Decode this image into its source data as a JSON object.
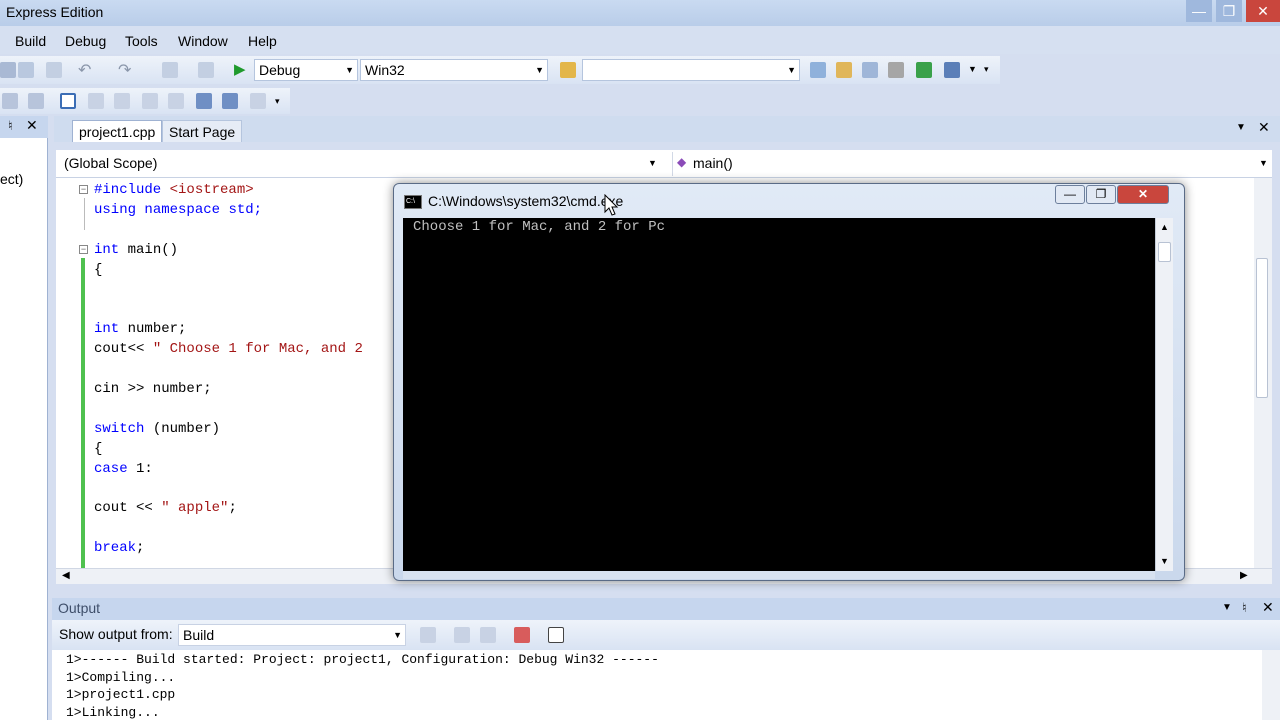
{
  "window": {
    "title": "Express Edition"
  },
  "menu": [
    "Build",
    "Debug",
    "Tools",
    "Window",
    "Help"
  ],
  "toolbar": {
    "config_value": "Debug",
    "platform_value": "Win32",
    "find_value": ""
  },
  "left_panel": {
    "text": "ect)"
  },
  "tabs": [
    {
      "label": "project1.cpp"
    },
    {
      "label": "Start Page"
    }
  ],
  "scope": {
    "left": "(Global Scope)",
    "right": "main()"
  },
  "code_lines": [
    "#include <iostream>",
    "using namespace std;",
    "int main()",
    "{",
    "int number;",
    "cout<< \" Choose 1 for Mac, and 2",
    "cin >> number;",
    "switch (number)",
    "{",
    "case 1:",
    "cout << \" apple\";",
    "break;"
  ],
  "output": {
    "title": "Output",
    "show_from_label": "Show output from:",
    "show_from_value": "Build",
    "lines": [
      "1>------ Build started: Project: project1, Configuration: Debug Win32 ------",
      "1>Compiling...",
      "1>project1.cpp",
      "1>Linking..."
    ]
  },
  "cmd": {
    "title": "C:\\Windows\\system32\\cmd.exe",
    "icon_text": "C:\\",
    "screen_text": "Choose 1 for Mac, and 2 for Pc"
  }
}
